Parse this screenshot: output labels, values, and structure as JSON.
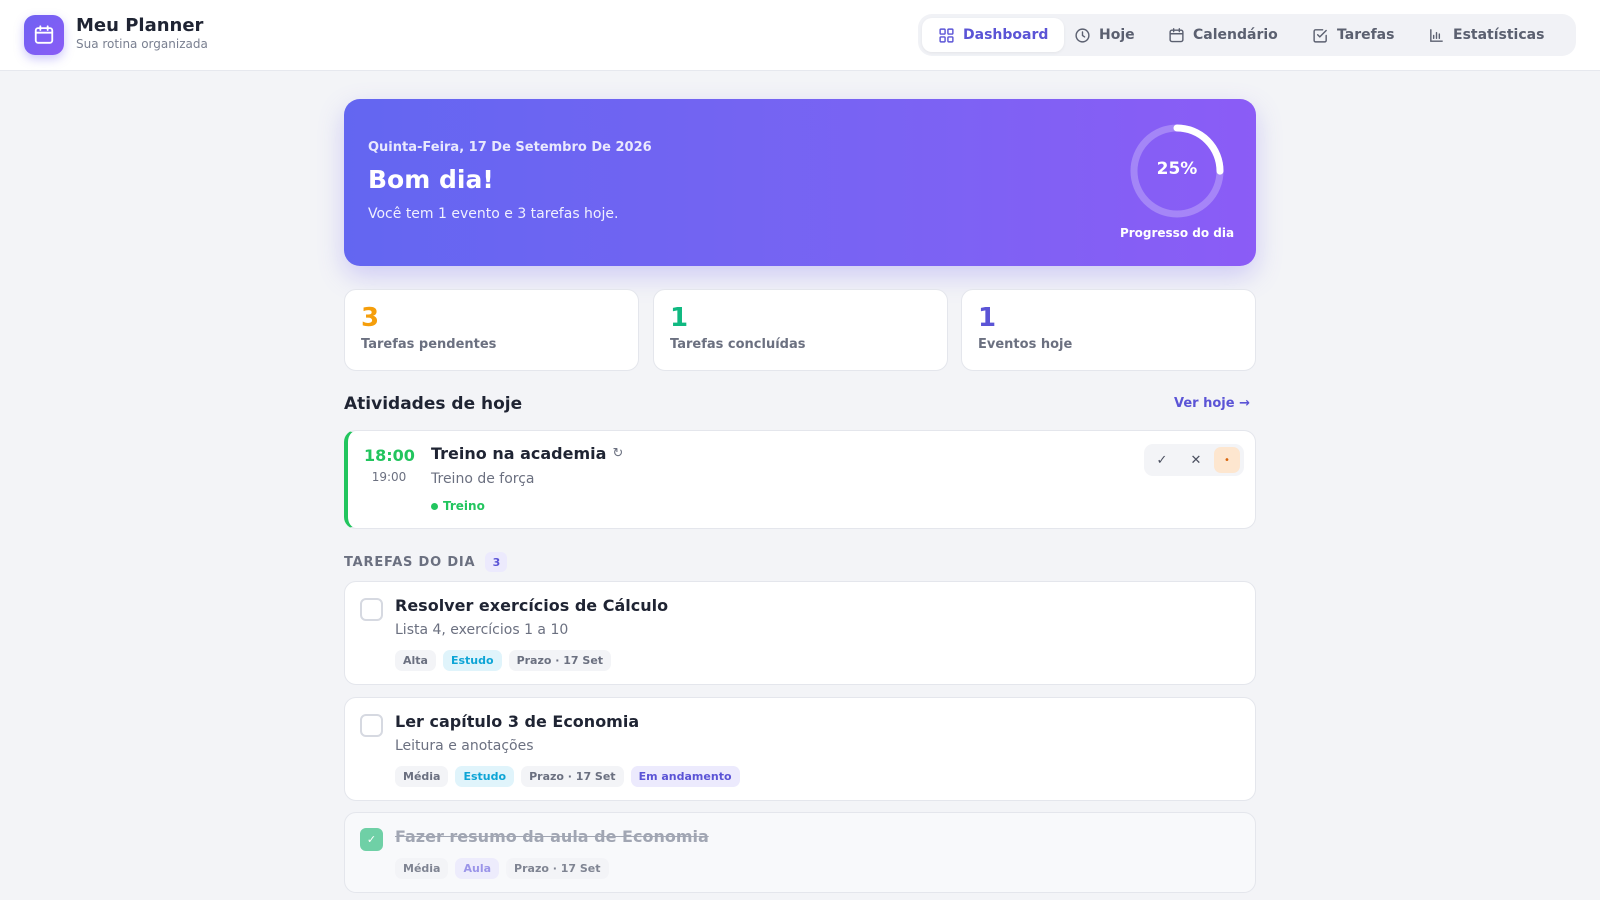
{
  "header": {
    "app_title": "Meu Planner",
    "app_subtitle": "Sua rotina organizada",
    "nav": [
      {
        "label": "Dashboard",
        "icon": "grid-icon",
        "active": true
      },
      {
        "label": "Hoje",
        "icon": "clock-icon",
        "active": false
      },
      {
        "label": "Calendário",
        "icon": "calendar-icon",
        "active": false
      },
      {
        "label": "Tarefas",
        "icon": "checkbox-icon",
        "active": false
      },
      {
        "label": "Estatísticas",
        "icon": "bar-chart-icon",
        "active": false
      }
    ]
  },
  "hero": {
    "date": "Quinta-Feira, 17 De Setembro De 2026",
    "greeting": "Bom dia!",
    "summary": "Você tem 1 evento e 3 tarefas hoje.",
    "progress_percent": 25,
    "progress_text": "25%",
    "progress_label": "Progresso do dia"
  },
  "stats": [
    {
      "value": "3",
      "label": "Tarefas pendentes",
      "color": "#f59e0b"
    },
    {
      "value": "1",
      "label": "Tarefas concluídas",
      "color": "#10b981"
    },
    {
      "value": "1",
      "label": "Eventos hoje",
      "color": "#5b54d6"
    }
  ],
  "activities": {
    "title": "Atividades de hoje",
    "link": "Ver hoje →",
    "event": {
      "start": "18:00",
      "end": "19:00",
      "title": "Treino na academia",
      "repeat_icon": "↻",
      "description": "Treino de força",
      "category": "Treino",
      "category_color": "#22c55e",
      "actions": {
        "confirm": "✓",
        "cancel": "✕",
        "status": "•"
      }
    }
  },
  "tasks": {
    "header": "TAREFAS DO DIA",
    "count": "3",
    "items": [
      {
        "title": "Resolver exercícios de Cálculo",
        "description": "Lista 4, exercícios 1 a 10",
        "priority": "Alta",
        "category": "Estudo",
        "due": "Prazo · 17 Set",
        "done": false
      },
      {
        "title": "Ler capítulo 3 de Economia",
        "description": "Leitura e anotações",
        "priority": "Média",
        "category": "Estudo",
        "due": "Prazo · 17 Set",
        "status": "Em andamento",
        "done": false
      },
      {
        "title": "Fazer resumo da aula de Economia",
        "priority": "Média",
        "category": "Aula",
        "due": "Prazo · 17 Set",
        "done": true,
        "check_mark": "✓"
      }
    ]
  },
  "colors": {
    "accent": "#5b54d6",
    "hero_start": "#6366f1",
    "hero_end": "#8b5cf6",
    "success": "#22c55e",
    "warning": "#f59e0b"
  }
}
